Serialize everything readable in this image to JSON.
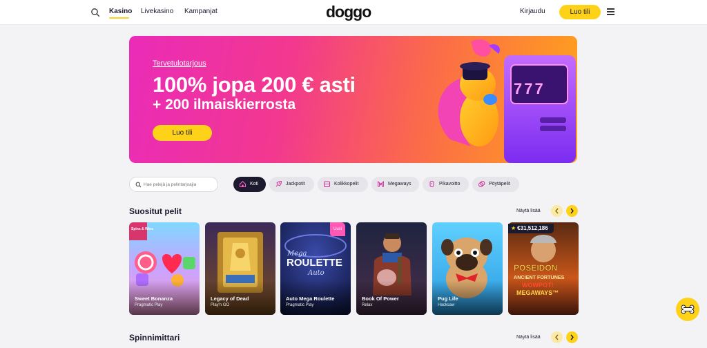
{
  "header": {
    "nav": [
      "Kasino",
      "Livekasino",
      "Kampanjat"
    ],
    "logo": "doggo",
    "login": "Kirjaudu",
    "signup": "Luo tili"
  },
  "hero": {
    "kicker": "Tervetulotarjous",
    "title": "100% jopa 200 € asti",
    "subtitle": "+ 200 ilmaiskierrosta",
    "cta": "Luo tili",
    "slot_display": "777"
  },
  "search": {
    "placeholder": "Hae pelejä ja pelintarjoajia"
  },
  "categories": [
    {
      "label": "Koti",
      "icon": "home-icon",
      "active": true
    },
    {
      "label": "Jackpotit",
      "icon": "rocket-icon",
      "active": false
    },
    {
      "label": "Kolikkopelit",
      "icon": "slots-icon",
      "active": false
    },
    {
      "label": "Megaways",
      "icon": "megaways-icon",
      "active": false
    },
    {
      "label": "Pikavoitto",
      "icon": "stopwatch-icon",
      "active": false
    },
    {
      "label": "Pöytäpelit",
      "icon": "chips-icon",
      "active": false
    }
  ],
  "sections": {
    "popular": {
      "title": "Suositut pelit",
      "show_more": "Näytä lisää"
    },
    "spins": {
      "title": "Spinnimittari",
      "show_more": "Näytä lisää"
    }
  },
  "games": [
    {
      "name": "Sweet Bonanza",
      "provider": "Pragmatic Play",
      "corner_tag": "Spins & Wins",
      "art_text": ""
    },
    {
      "name": "Legacy of Dead",
      "provider": "Play'n GO",
      "art_text": ""
    },
    {
      "name": "Auto Mega Roulette",
      "provider": "Pragmatic Play",
      "badge": "Uusi",
      "art_text": "ROULETTE",
      "art_script_1": "Mega",
      "art_script_2": "Auto"
    },
    {
      "name": "Book Of Power",
      "provider": "Relax",
      "art_text": ""
    },
    {
      "name": "Pug Life",
      "provider": "Hacksaw",
      "art_text": ""
    },
    {
      "name": "",
      "provider": "",
      "jackpot": "€31,512,186",
      "art_line_1": "POSEIDON",
      "art_line_2": "ANCIENT FORTUNES",
      "art_line_3": "WOWPOT!",
      "art_line_4": "MEGAWAYS™"
    }
  ],
  "colors": {
    "accent": "#ffd21a",
    "dark": "#1b1a2e",
    "hero_start": "#ea2bb8",
    "hero_end": "#ffa21c",
    "new_badge": "#ff58b5"
  }
}
